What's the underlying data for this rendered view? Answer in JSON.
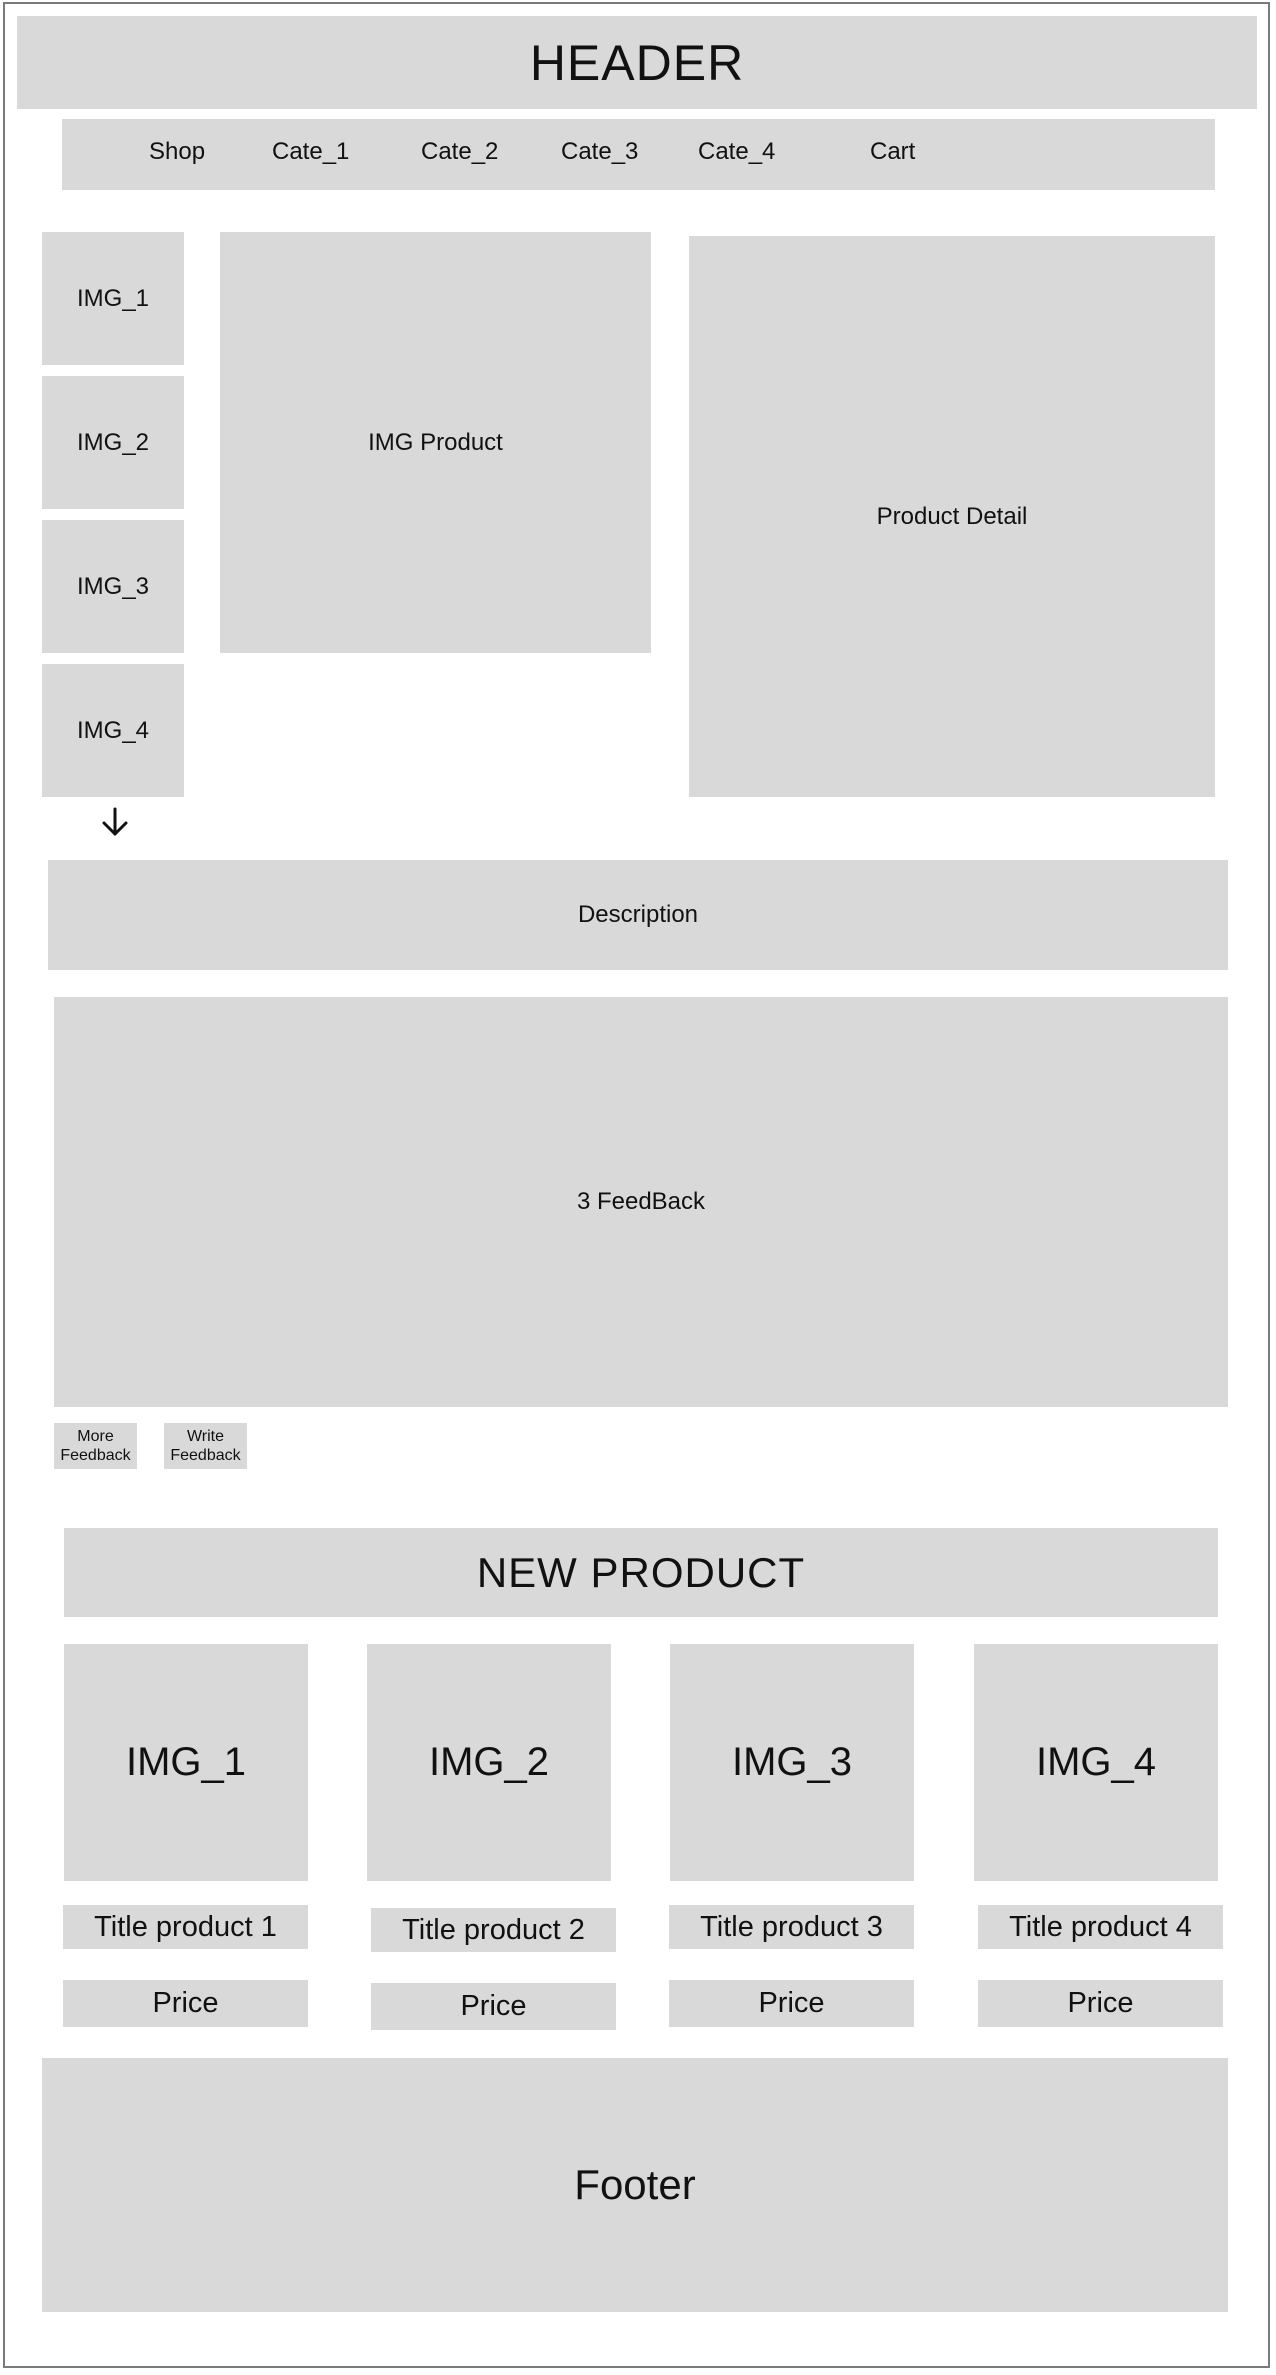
{
  "header": {
    "title": "HEADER"
  },
  "nav": {
    "items": [
      "Shop",
      "Cate_1",
      "Cate_2",
      "Cate_3",
      "Cate_4",
      "Cart"
    ]
  },
  "gallery": {
    "thumbnails": [
      "IMG_1",
      "IMG_2",
      "IMG_3",
      "IMG_4"
    ],
    "scroll_icon": "arrow-down-icon",
    "main_image": "IMG Product"
  },
  "product_detail": {
    "label": "Product Detail"
  },
  "description": {
    "label": "Description"
  },
  "feedback": {
    "label": "3 FeedBack",
    "more_button": [
      "More",
      "Feedback"
    ],
    "write_button": [
      "Write",
      "Feedback"
    ]
  },
  "new_product": {
    "title": "NEW PRODUCT",
    "products": [
      {
        "image": "IMG_1",
        "title": "Title product 1",
        "price": "Price"
      },
      {
        "image": "IMG_2",
        "title": "Title product 2",
        "price": "Price"
      },
      {
        "image": "IMG_3",
        "title": "Title product 3",
        "price": "Price"
      },
      {
        "image": "IMG_4",
        "title": "Title product 4",
        "price": "Price"
      }
    ]
  },
  "footer": {
    "label": "Footer"
  },
  "colors": {
    "placeholder": "#d9d9d9",
    "border": "#7a7a7a",
    "text": "#111111"
  }
}
